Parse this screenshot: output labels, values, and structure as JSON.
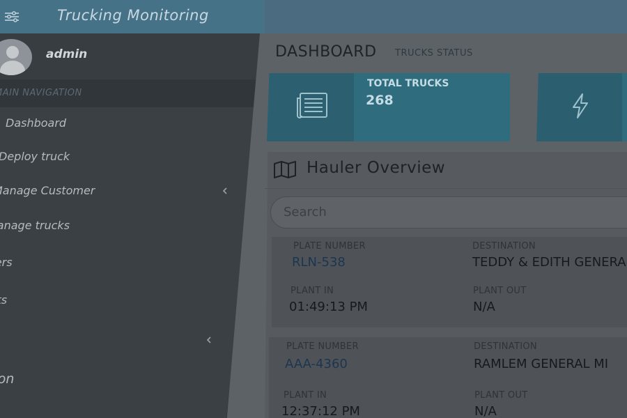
{
  "app": {
    "title": "Trucking Monitoring"
  },
  "user": {
    "name": "admin"
  },
  "nav": {
    "header": "MAIN NAVIGATION",
    "items": [
      {
        "label": "Dashboard"
      },
      {
        "label": "Deploy truck"
      },
      {
        "label": "Manage Customer"
      },
      {
        "label": "Manage trucks"
      },
      {
        "label": "Drivers"
      },
      {
        "label": "Reports"
      },
      {
        "label": ""
      },
      {
        "label": "Documentation"
      }
    ]
  },
  "dashboard": {
    "title": "DASHBOARD",
    "subtitle": "TRUCKS STATUS",
    "info_boxes": [
      {
        "label": "TOTAL TRUCKS",
        "value": "268",
        "icon": "newspaper-icon"
      },
      {
        "label": "",
        "value": "",
        "icon": "bolt-icon"
      }
    ]
  },
  "hauler": {
    "title": "Hauler Overview",
    "search_placeholder": "Search",
    "labels": {
      "plate": "PLATE NUMBER",
      "destination": "DESTINATION",
      "plant_in": "PLANT IN",
      "plant_out": "PLANT OUT"
    },
    "records": [
      {
        "plate": "RLN-538",
        "destination": "TEDDY & EDITH GENERAL",
        "plant_in": "01:49:13 PM",
        "plant_out": "N/A"
      },
      {
        "plate": "AAA-4360",
        "destination": "RAMLEM GENERAL MI",
        "plant_in": "12:37:12 PM",
        "plant_out": "N/A"
      }
    ]
  },
  "colors": {
    "topbar": "#4a6b80",
    "sidebar": "#3a4044",
    "info_box": "#2f6c7e",
    "link": "#1c3550"
  }
}
